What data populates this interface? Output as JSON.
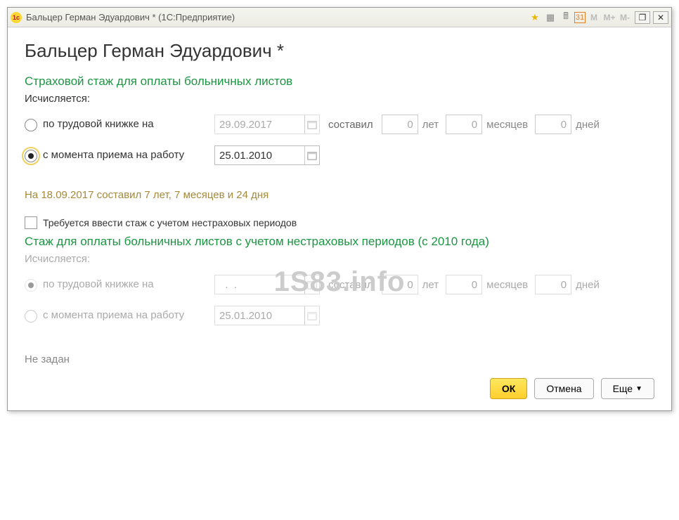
{
  "window": {
    "title": "Бальцер Герман Эдуардович * (1С:Предприятие)"
  },
  "header": {
    "title": "Бальцер Герман Эдуардович *"
  },
  "section1": {
    "title": "Страховой стаж для оплаты больничных листов",
    "calc_label": "Исчисляется:",
    "opt1_label": "по трудовой книжке на",
    "opt1_date": "29.09.2017",
    "opt2_label": "с момента приема на работу",
    "opt2_date": "25.01.2010",
    "compose_label": "составил",
    "years": "0",
    "years_unit": "лет",
    "months": "0",
    "months_unit": "месяцев",
    "days": "0",
    "days_unit": "дней",
    "summary": "На 18.09.2017 составил 7 лет, 7 месяцев и 24 дня"
  },
  "checkbox": {
    "label": "Требуется ввести стаж с учетом нестраховых периодов"
  },
  "section2": {
    "title": "Стаж для оплаты больничных листов с учетом нестраховых периодов (с 2010 года)",
    "calc_label": "Исчисляется:",
    "opt1_label": "по трудовой книжке на",
    "opt1_date": "  .  .    ",
    "opt2_label": "с момента приема на работу",
    "opt2_date": "25.01.2010",
    "compose_label": "составил",
    "years": "0",
    "years_unit": "лет",
    "months": "0",
    "months_unit": "месяцев",
    "days": "0",
    "days_unit": "дней",
    "not_set": "Не задан"
  },
  "footer": {
    "ok": "ОК",
    "cancel": "Отмена",
    "more": "Еще"
  },
  "watermark": "1S83.info",
  "title_m": {
    "m": "M",
    "mplus": "M+",
    "mminus": "M-"
  }
}
